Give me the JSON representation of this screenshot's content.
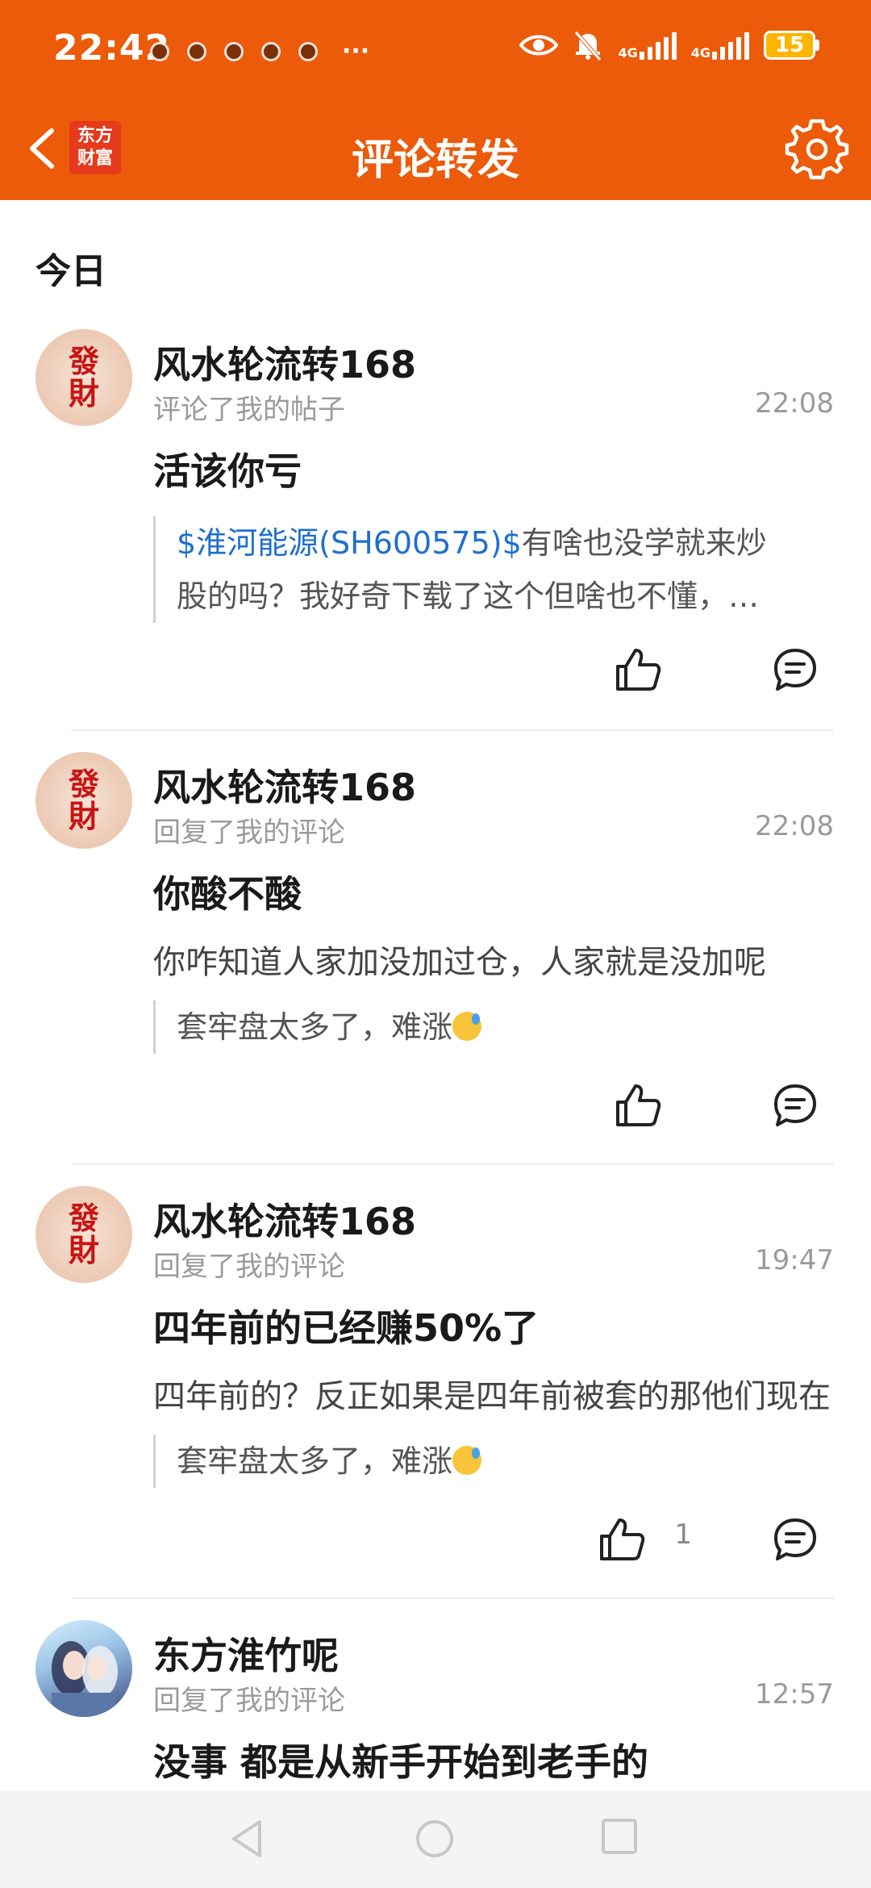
{
  "status": {
    "time": "22:42",
    "more": "···",
    "net1": "4G",
    "net2": "4G",
    "battery": "15"
  },
  "header": {
    "title": "评论转发",
    "logo_line1": "东方",
    "logo_line2": "财富"
  },
  "section": "今日",
  "items": [
    {
      "username": "风水轮流转168",
      "action": "评论了我的帖子",
      "time": "22:08",
      "comment": "活该你亏",
      "quote_stock": "$淮河能源(SH600575)$",
      "quote_line1_rest": "有啥也没学就来炒",
      "quote_line2": "股的吗？我好奇下载了这个但啥也不懂，…"
    },
    {
      "username": "风水轮流转168",
      "action": "回复了我的评论",
      "time": "22:08",
      "comment": "你酸不酸",
      "subtext": "你咋知道人家加没加过仓，人家就是没加呢",
      "quote": "套牢盘太多了，难涨"
    },
    {
      "username": "风水轮流转168",
      "action": "回复了我的评论",
      "time": "19:47",
      "comment": "四年前的已经赚50%了",
      "subtext": "四年前的？反正如果是四年前被套的那他们现在",
      "quote": "套牢盘太多了，难涨",
      "likes": "1"
    },
    {
      "username": "东方淮竹呢",
      "action": "回复了我的评论",
      "time": "12:57",
      "comment": "没事 都是从新手开始到老手的"
    }
  ],
  "avatar": {
    "glyph1": "發",
    "glyph2": "財"
  },
  "colors": {
    "brand": "#ec5b09",
    "link": "#1e6fd0",
    "muted": "#9a9a9a"
  }
}
